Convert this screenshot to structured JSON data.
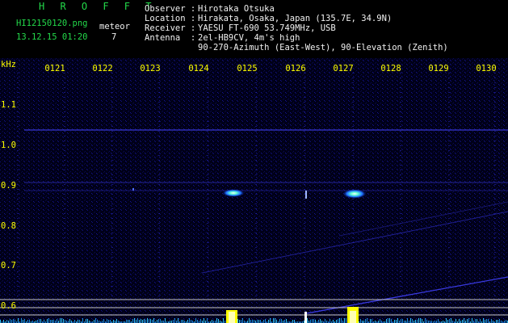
{
  "brand": "H R O F F T",
  "file": {
    "name": "HI12150120.png",
    "datetime": "13.12.15 01:20"
  },
  "meteor": {
    "label": "meteor",
    "count": "7"
  },
  "info": {
    "observer_label": "Observer :",
    "observer": "Hirotaka Otsuka",
    "location_label": "Location :",
    "location": "Hirakata, Osaka, Japan (135.7E, 34.9N)",
    "receiver_label": "Receiver :",
    "receiver": "YAESU FT-690 53.749MHz, USB",
    "antenna_label": "Antenna  :",
    "antenna": "2el-HB9CV, 4m's high",
    "antenna_line2": "90-270-Azimuth (East-West), 90-Elevation (Zenith)"
  },
  "axis": {
    "unit": "kHz",
    "time_ticks": [
      "0121",
      "0122",
      "0123",
      "0124",
      "0125",
      "0126",
      "0127",
      "0128",
      "0129",
      "0130"
    ],
    "freq_ticks": [
      "1.1",
      "1.0",
      "0.9",
      "0.8",
      "0.7",
      "0.6"
    ]
  },
  "colors": {
    "header_green": "#23d94a",
    "label_yellow": "#ffff00",
    "background": "#000010"
  }
}
